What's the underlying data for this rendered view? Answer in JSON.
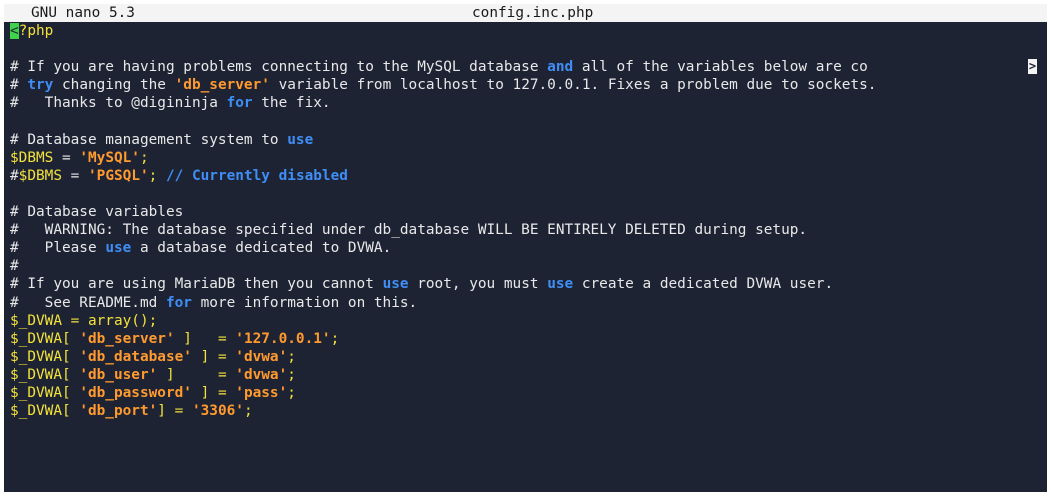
{
  "titlebar": {
    "app": "GNU nano 5.3",
    "file": "config.inc.php"
  },
  "lines": [
    {
      "segments": [
        {
          "t": "<",
          "c": "cursor"
        },
        {
          "t": "?php",
          "c": "var"
        }
      ]
    },
    {
      "segments": []
    },
    {
      "segments": [
        {
          "t": "# If you are having problems connecting to the MySQL database ",
          "c": "plain"
        },
        {
          "t": "and",
          "c": "kw"
        },
        {
          "t": " all of the variables below are co",
          "c": "plain"
        }
      ],
      "overflow": true
    },
    {
      "segments": [
        {
          "t": "# ",
          "c": "plain"
        },
        {
          "t": "try",
          "c": "kw"
        },
        {
          "t": " changing the ",
          "c": "plain"
        },
        {
          "t": "'db_server'",
          "c": "str"
        },
        {
          "t": " variable from localhost to 127.0.0.1. Fixes a problem due to sockets.",
          "c": "plain"
        }
      ]
    },
    {
      "segments": [
        {
          "t": "#   Thanks to @digininja ",
          "c": "plain"
        },
        {
          "t": "for",
          "c": "kw"
        },
        {
          "t": " the fix.",
          "c": "plain"
        }
      ]
    },
    {
      "segments": []
    },
    {
      "segments": [
        {
          "t": "# Database management system to ",
          "c": "plain"
        },
        {
          "t": "use",
          "c": "kw"
        }
      ]
    },
    {
      "segments": [
        {
          "t": "$DBMS",
          "c": "var"
        },
        {
          "t": " = ",
          "c": "plain"
        },
        {
          "t": "'MySQL'",
          "c": "str"
        },
        {
          "t": ";",
          "c": "var"
        }
      ]
    },
    {
      "segments": [
        {
          "t": "#",
          "c": "plain"
        },
        {
          "t": "$DBMS",
          "c": "var"
        },
        {
          "t": " = ",
          "c": "plain"
        },
        {
          "t": "'PGSQL'",
          "c": "str"
        },
        {
          "t": "; ",
          "c": "var"
        },
        {
          "t": "// Currently disabled",
          "c": "cm"
        }
      ]
    },
    {
      "segments": []
    },
    {
      "segments": [
        {
          "t": "# Database variables",
          "c": "plain"
        }
      ]
    },
    {
      "segments": [
        {
          "t": "#   WARNING: The database specified under db_database WILL BE ENTIRELY DELETED during setup.",
          "c": "plain"
        }
      ]
    },
    {
      "segments": [
        {
          "t": "#   Please ",
          "c": "plain"
        },
        {
          "t": "use",
          "c": "kw"
        },
        {
          "t": " a database dedicated to DVWA.",
          "c": "plain"
        }
      ]
    },
    {
      "segments": [
        {
          "t": "#",
          "c": "plain"
        }
      ]
    },
    {
      "segments": [
        {
          "t": "# If you are using MariaDB then you cannot ",
          "c": "plain"
        },
        {
          "t": "use",
          "c": "kw"
        },
        {
          "t": " root, you must ",
          "c": "plain"
        },
        {
          "t": "use",
          "c": "kw"
        },
        {
          "t": " create a dedicated DVWA user.",
          "c": "plain"
        }
      ]
    },
    {
      "segments": [
        {
          "t": "#   See README.md ",
          "c": "plain"
        },
        {
          "t": "for",
          "c": "kw"
        },
        {
          "t": " more information on this.",
          "c": "plain"
        }
      ]
    },
    {
      "segments": [
        {
          "t": "$_DVWA = array();",
          "c": "var"
        }
      ]
    },
    {
      "segments": [
        {
          "t": "$_DVWA[ ",
          "c": "var"
        },
        {
          "t": "'db_server'",
          "c": "str"
        },
        {
          "t": " ]   = ",
          "c": "var"
        },
        {
          "t": "'127.0.0.1'",
          "c": "str"
        },
        {
          "t": ";",
          "c": "var"
        }
      ]
    },
    {
      "segments": [
        {
          "t": "$_DVWA[ ",
          "c": "var"
        },
        {
          "t": "'db_database'",
          "c": "str"
        },
        {
          "t": " ] = ",
          "c": "var"
        },
        {
          "t": "'dvwa'",
          "c": "str"
        },
        {
          "t": ";",
          "c": "var"
        }
      ]
    },
    {
      "segments": [
        {
          "t": "$_DVWA[ ",
          "c": "var"
        },
        {
          "t": "'db_user'",
          "c": "str"
        },
        {
          "t": " ]     = ",
          "c": "var"
        },
        {
          "t": "'dvwa'",
          "c": "str"
        },
        {
          "t": ";",
          "c": "var"
        }
      ]
    },
    {
      "segments": [
        {
          "t": "$_DVWA[ ",
          "c": "var"
        },
        {
          "t": "'db_password'",
          "c": "str"
        },
        {
          "t": " ] = ",
          "c": "var"
        },
        {
          "t": "'pass'",
          "c": "str"
        },
        {
          "t": ";",
          "c": "var"
        }
      ]
    },
    {
      "segments": [
        {
          "t": "$_DVWA[ ",
          "c": "var"
        },
        {
          "t": "'db_port'",
          "c": "str"
        },
        {
          "t": "] = ",
          "c": "var"
        },
        {
          "t": "'3306'",
          "c": "str"
        },
        {
          "t": ";",
          "c": "var"
        }
      ]
    }
  ],
  "overflow_marker": ">",
  "colors": {
    "background": "#1e2334",
    "titlebar": "#f4f4f4",
    "keyword": "#3f8ef5",
    "string": "#ff9a2e",
    "variable": "#f2e23a",
    "cursor": "#3fd34c"
  }
}
